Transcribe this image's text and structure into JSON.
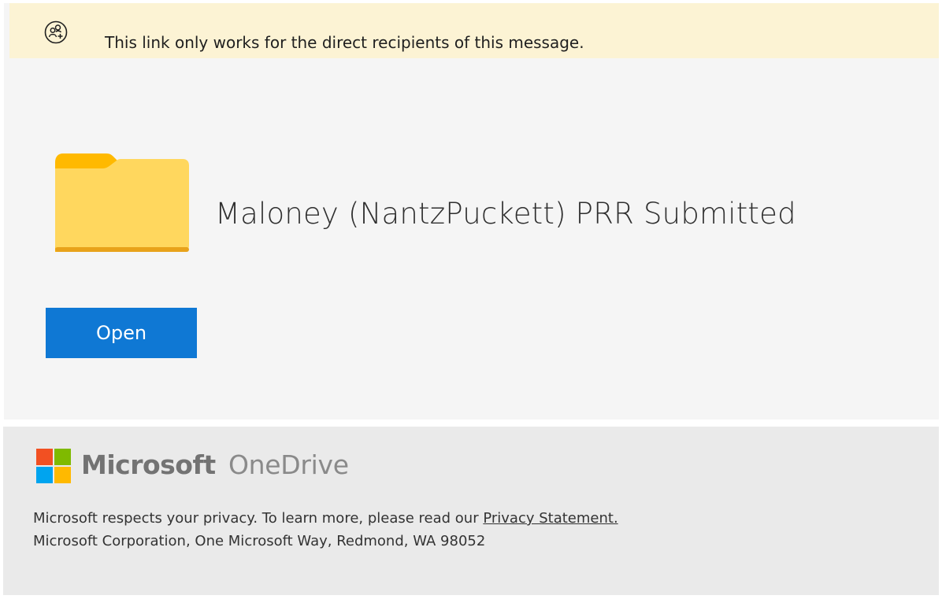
{
  "notice": {
    "text": "This link only works for the direct recipients of this message.",
    "icon": "restricted-people-icon"
  },
  "item": {
    "icon": "folder-icon",
    "name": "Maloney (NantzPuckett) PRR Submitted"
  },
  "actions": {
    "open_label": "Open"
  },
  "colors": {
    "notice_bg": "#fcf3d4",
    "panel_bg": "#f5f5f5",
    "footer_bg": "#eaeaea",
    "button_bg": "#0f78d4",
    "folder_tab": "#ffb900",
    "folder_body": "#ffd75e"
  },
  "footer": {
    "brand_microsoft": "Microsoft",
    "brand_product": "OneDrive",
    "privacy_prefix": "Microsoft respects your privacy. To learn more, please read our ",
    "privacy_link": "Privacy Statement.",
    "address": "Microsoft Corporation, One Microsoft Way, Redmond, WA 98052"
  }
}
